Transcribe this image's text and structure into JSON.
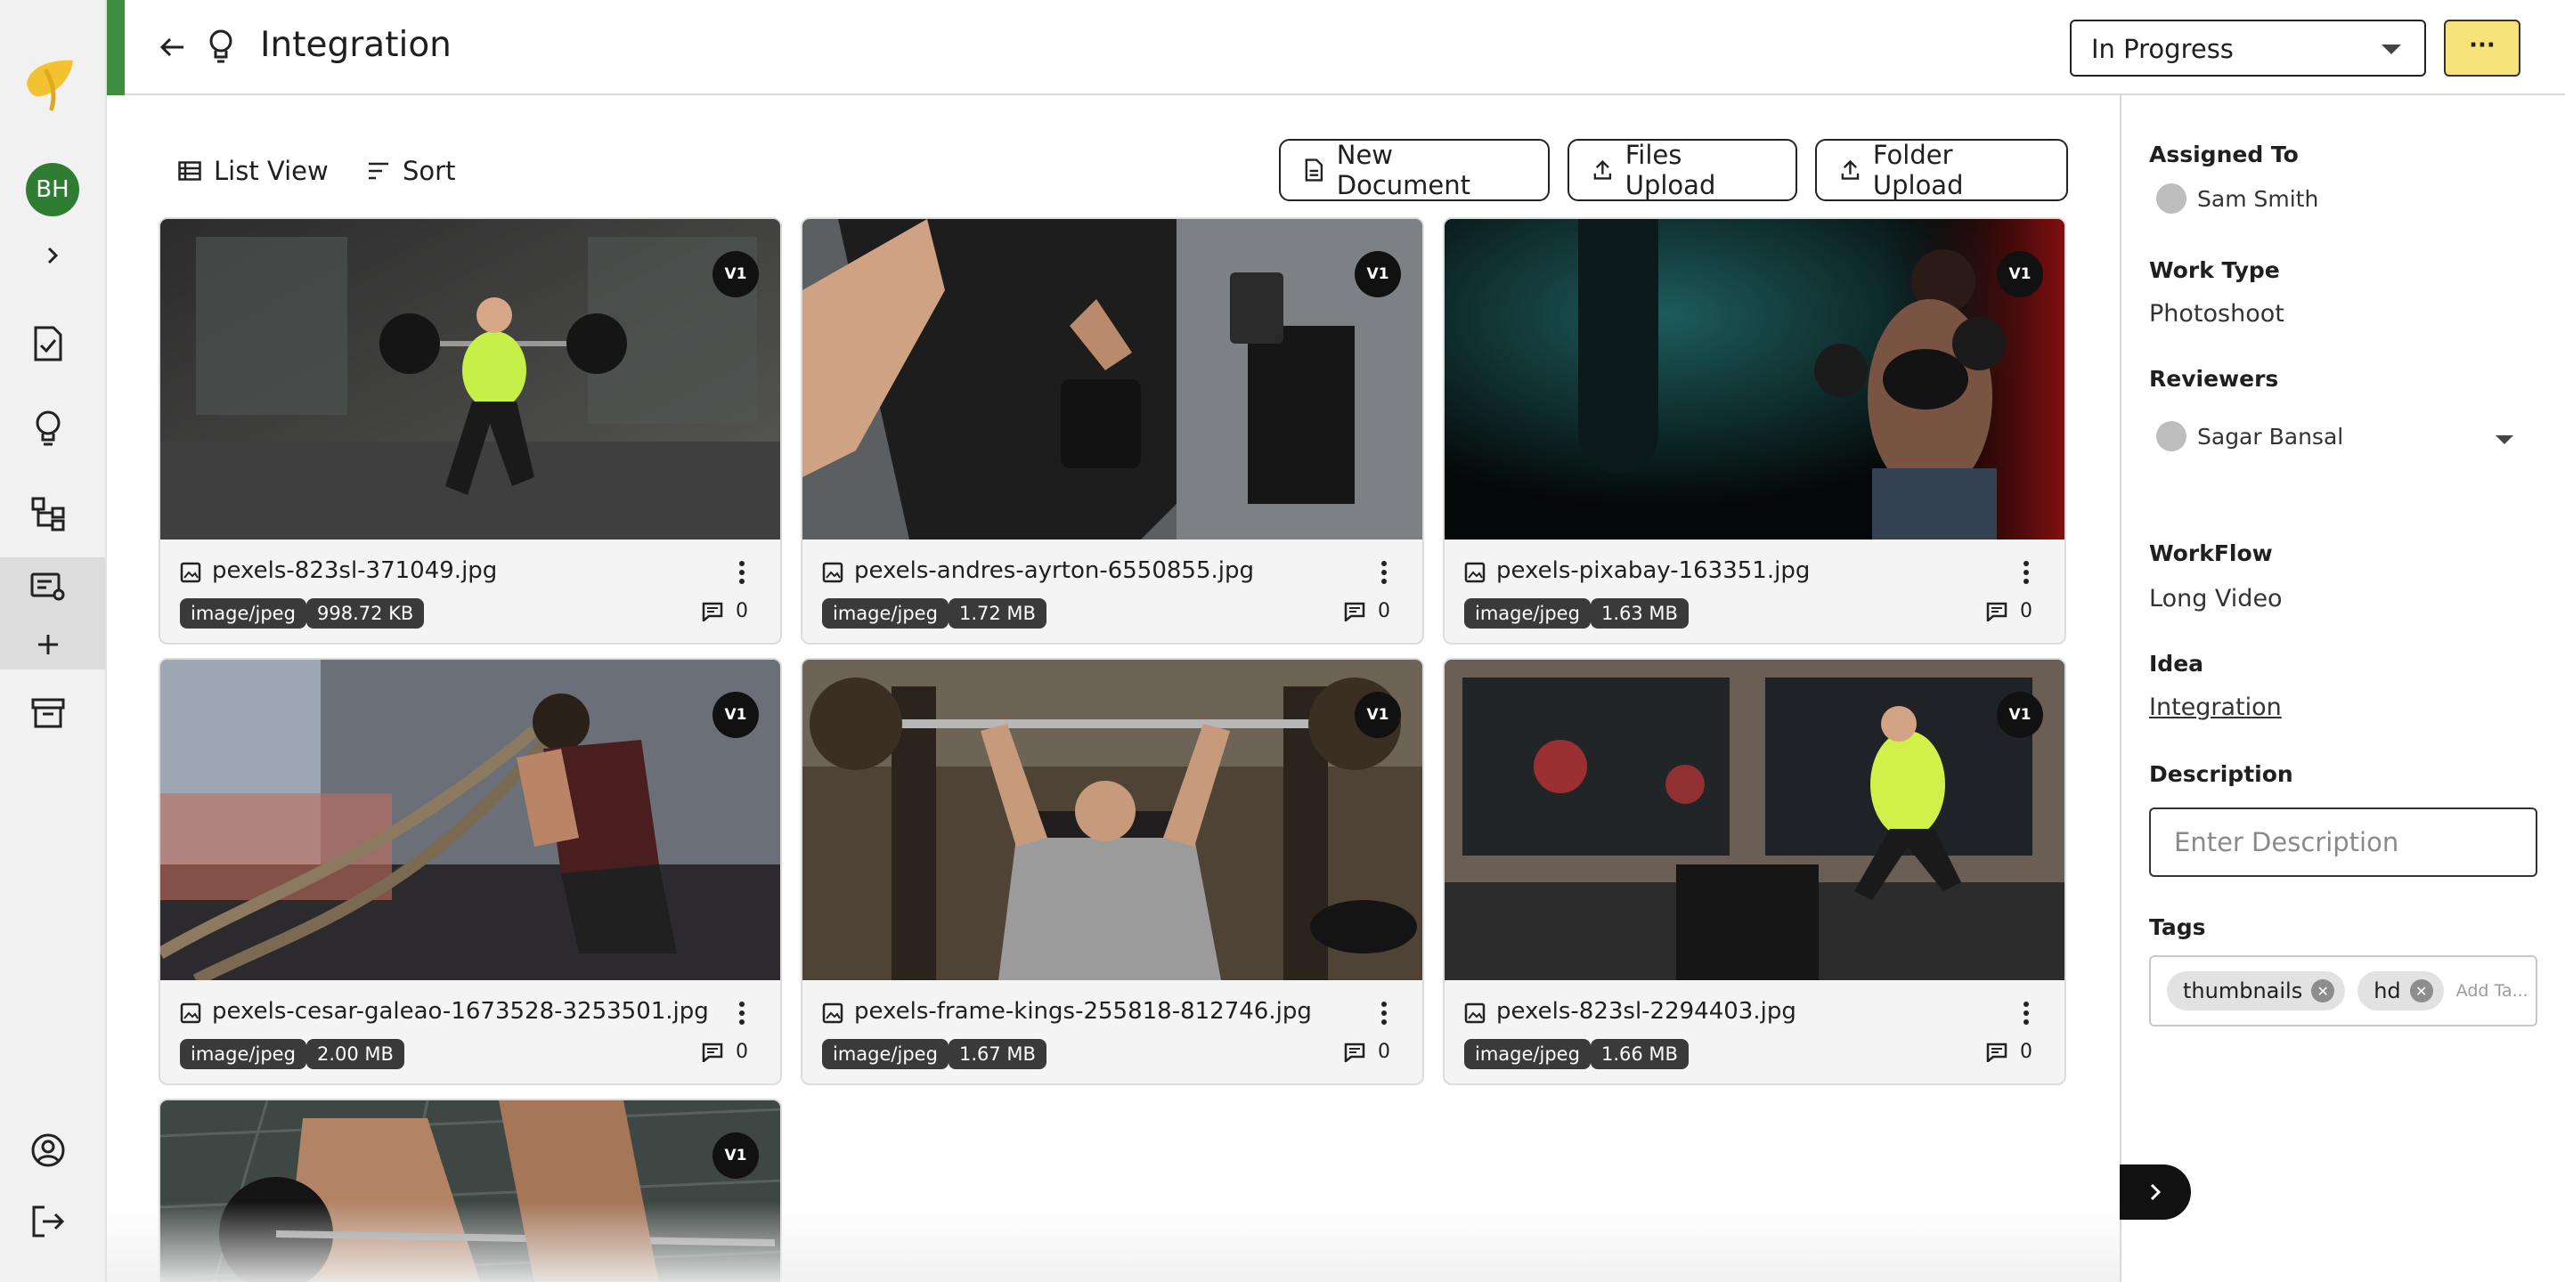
{
  "app": {
    "user_initials": "BH"
  },
  "header": {
    "title": "Integration",
    "status": "In Progress",
    "more_label": "···"
  },
  "toolbar": {
    "list_view_label": "List View",
    "sort_label": "Sort",
    "new_document_label": "New Document",
    "files_upload_label": "Files Upload",
    "folder_upload_label": "Folder Upload"
  },
  "files": [
    {
      "name": "pexels-823sl-371049.jpg",
      "type": "image/jpeg",
      "size": "998.72 KB",
      "version": "V1",
      "comments": "0"
    },
    {
      "name": "pexels-andres-ayrton-6550855.jpg",
      "type": "image/jpeg",
      "size": "1.72 MB",
      "version": "V1",
      "comments": "0"
    },
    {
      "name": "pexels-pixabay-163351.jpg",
      "type": "image/jpeg",
      "size": "1.63 MB",
      "version": "V1",
      "comments": "0"
    },
    {
      "name": "pexels-cesar-galeao-1673528-3253501.jpg",
      "type": "image/jpeg",
      "size": "2.00 MB",
      "version": "V1",
      "comments": "0"
    },
    {
      "name": "pexels-frame-kings-255818-812746.jpg",
      "type": "image/jpeg",
      "size": "1.67 MB",
      "version": "V1",
      "comments": "0"
    },
    {
      "name": "pexels-823sl-2294403.jpg",
      "type": "image/jpeg",
      "size": "1.66 MB",
      "version": "V1",
      "comments": "0"
    },
    {
      "version": "V1"
    }
  ],
  "details": {
    "assigned_to_label": "Assigned To",
    "assigned_to": "Sam Smith",
    "work_type_label": "Work Type",
    "work_type": "Photoshoot",
    "reviewers_label": "Reviewers",
    "reviewer": "Sagar Bansal",
    "workflow_label": "WorkFlow",
    "workflow": "Long Video",
    "idea_label": "Idea",
    "idea": "Integration",
    "description_label": "Description",
    "description_placeholder": "Enter Description",
    "tags_label": "Tags",
    "tags": [
      "thumbnails",
      "hd"
    ],
    "tag_placeholder": "Add Ta..."
  },
  "colors": {
    "accent_green": "#3e8e41",
    "avatar_green": "#2e7d32",
    "more_button_yellow": "#f6e47a",
    "logo_yellow": "#f2c230"
  }
}
